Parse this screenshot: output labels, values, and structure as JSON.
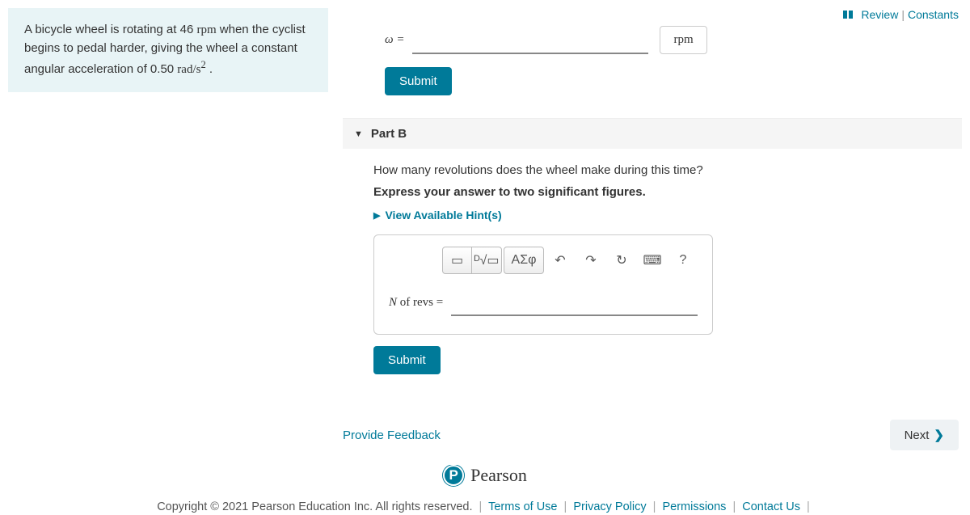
{
  "topLinks": {
    "review": "Review",
    "constants": "Constants"
  },
  "problem": {
    "text_before_rpm": "A bicycle wheel is rotating at 46 ",
    "rpm": "rpm",
    "text_mid": " when the cyclist begins to pedal harder, giving the wheel a constant angular acceleration of 0.50 ",
    "accel_unit": "rad/s",
    "accel_exp": "2",
    "text_end": " ."
  },
  "partA": {
    "label": "ω =",
    "unit": "rpm",
    "submit": "Submit"
  },
  "partB": {
    "title": "Part B",
    "question": "How many revolutions does the wheel make during this time?",
    "instruction": "Express your answer to two significant figures.",
    "hints": "View Available Hint(s)",
    "label_prefix": "N",
    "label_rest": " of revs =",
    "submit": "Submit",
    "toolbar": {
      "template": "▭",
      "radical": "ᴰ√▭",
      "greek": "ΑΣφ",
      "undo": "↶",
      "redo": "↷",
      "reset": "↻",
      "keyboard": "⌨",
      "help": "?"
    }
  },
  "feedback": "Provide Feedback",
  "next": "Next",
  "pearson": "Pearson",
  "copyright": "Copyright © 2021 Pearson Education Inc. All rights reserved.",
  "footerLinks": {
    "terms": "Terms of Use",
    "privacy": "Privacy Policy",
    "permissions": "Permissions",
    "contact": "Contact Us"
  }
}
